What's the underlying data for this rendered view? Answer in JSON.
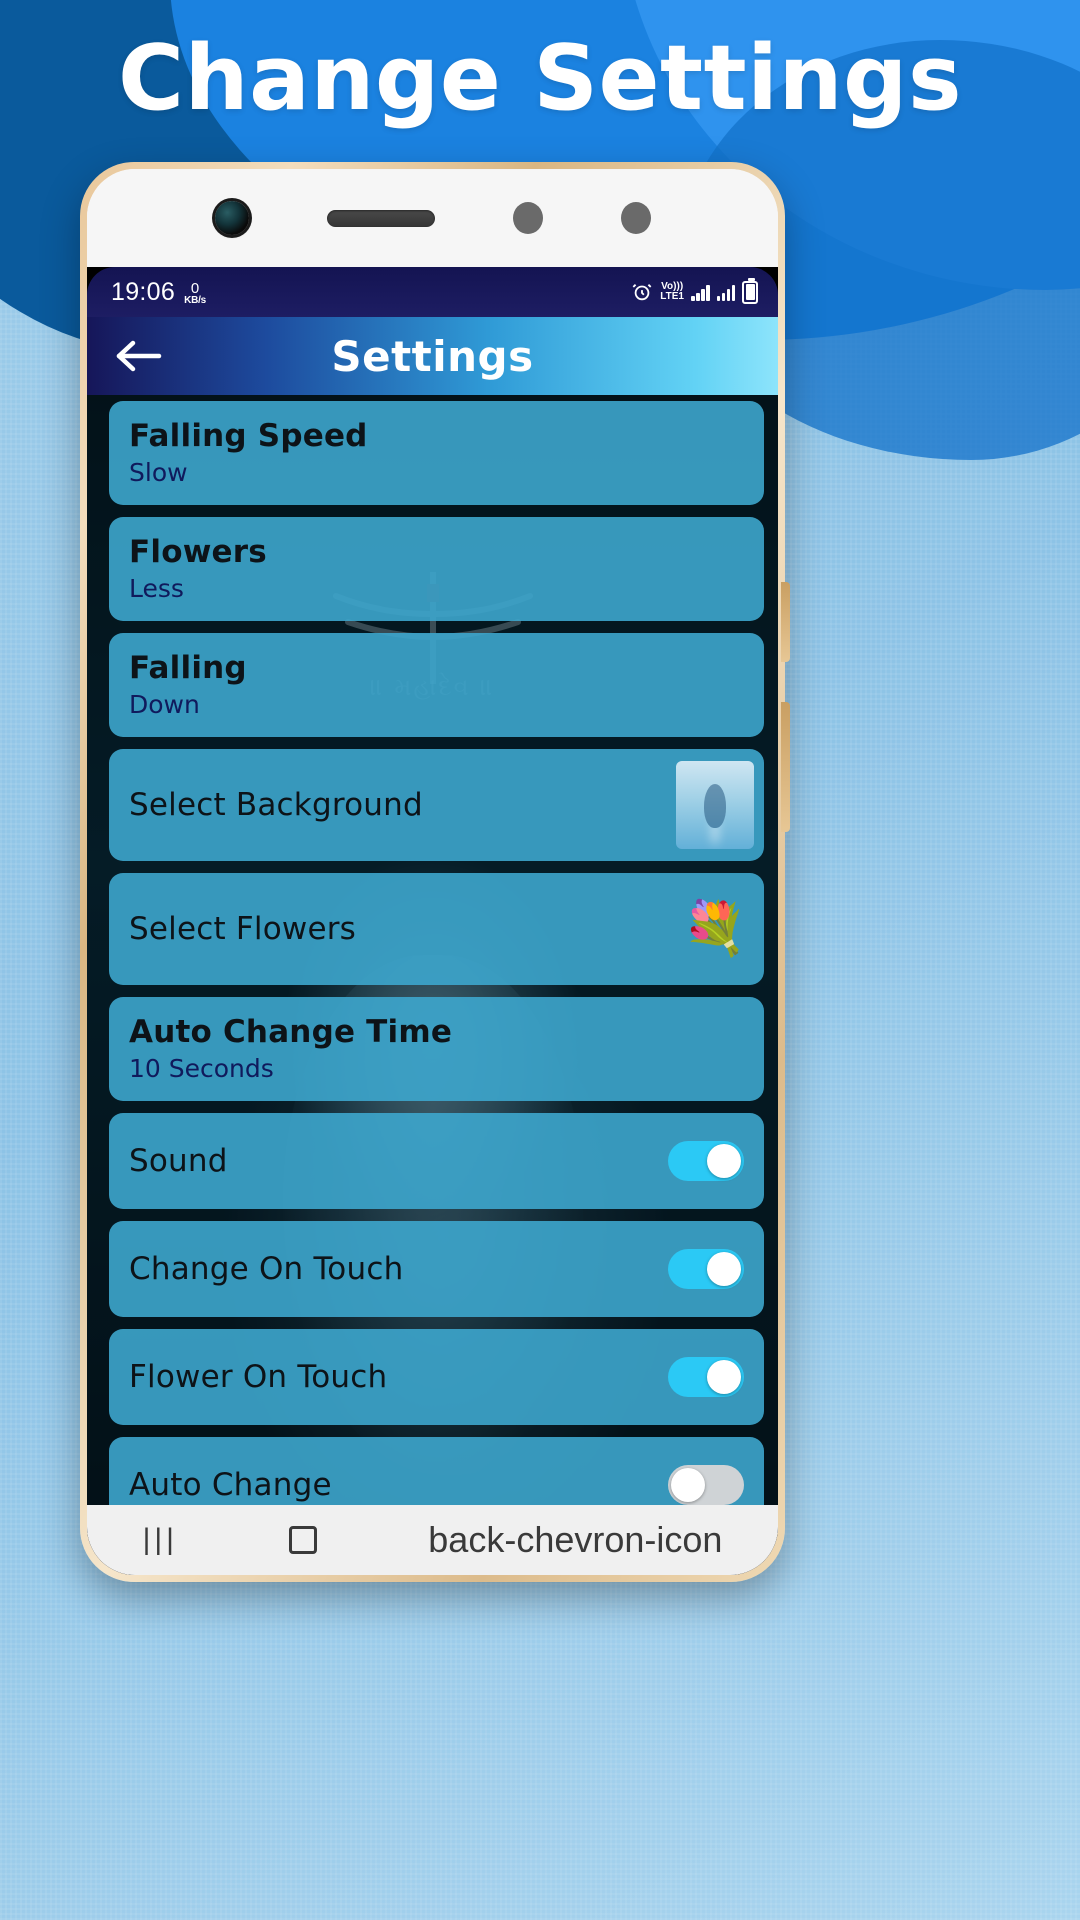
{
  "promo": {
    "title": "Change Settings",
    "title_color": "#ffffff",
    "bg_color": "#8fc4e8",
    "accent_color": "#1b82e0"
  },
  "statusbar": {
    "time": "19:06",
    "netspeed_value": "0",
    "netspeed_unit": "KB/s",
    "alarm_icon": "alarm-clock-icon",
    "volte_top": "Vo)))",
    "volte_bottom": "LTE1",
    "signal_icon": "signal-bars-icon",
    "signal2_icon": "signal-bars-icon",
    "battery_icon": "battery-full-icon"
  },
  "appbar": {
    "back_icon": "back-arrow-icon",
    "title": "Settings"
  },
  "wallpaper": {
    "mantra_text": "॥ મહાદેવ ॥",
    "trident_icon": "trident-icon"
  },
  "settings": {
    "items": [
      {
        "title": "Falling Speed",
        "sub": "Slow",
        "type": "value"
      },
      {
        "title": "Flowers",
        "sub": "Less",
        "type": "value"
      },
      {
        "title": "Falling",
        "sub": "Down",
        "type": "value"
      },
      {
        "title": "Select Background",
        "sub": "",
        "type": "thumb",
        "thumb": "background-preview-thumbnail"
      },
      {
        "title": "Select Flowers",
        "sub": "",
        "type": "thumb",
        "thumb": "flowers-preview-thumbnail",
        "glyph": "💐"
      },
      {
        "title": "Auto Change Time",
        "sub": "10 Seconds",
        "type": "value"
      },
      {
        "title": "Sound",
        "sub": "",
        "type": "toggle",
        "toggle": "on"
      },
      {
        "title": "Change On Touch",
        "sub": "",
        "type": "toggle",
        "toggle": "on"
      },
      {
        "title": "Flower On Touch",
        "sub": "",
        "type": "toggle",
        "toggle": "on"
      },
      {
        "title": "Auto Change",
        "sub": "",
        "type": "toggle",
        "toggle": "off"
      }
    ],
    "card_color": "#3da6cd",
    "toggle_on_color": "#2bc9f5",
    "toggle_off_color": "#cfd3d6"
  },
  "navbar": {
    "recent_icon": "|||",
    "home_icon": "home-square-icon",
    "back_icon": "back-chevron-icon"
  }
}
